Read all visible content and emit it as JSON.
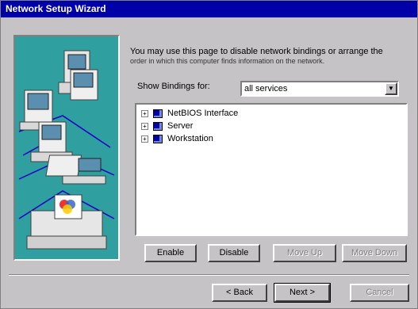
{
  "window": {
    "title": "Network Setup Wizard"
  },
  "description": {
    "line1": "You may use this page to disable network bindings or arrange the",
    "line2": "order in which this computer finds information on the network."
  },
  "bindings": {
    "show_label": "Show Bindings for:",
    "selected": "all services"
  },
  "tree": {
    "items": [
      {
        "expander": "+",
        "label": "NetBIOS Interface"
      },
      {
        "expander": "+",
        "label": "Server"
      },
      {
        "expander": "+",
        "label": "Workstation"
      }
    ]
  },
  "actions": {
    "enable": "Enable",
    "disable": "Disable",
    "move_up": "Move Up",
    "move_down": "Move Down"
  },
  "nav": {
    "back": "< Back",
    "next": "Next >",
    "cancel": "Cancel"
  },
  "colors": {
    "title_bar": "#0000a8",
    "illustration_bg": "#2f9f9f",
    "face": "#c6c3c6"
  },
  "icons": {
    "illustration": "network-computers-illustration",
    "binding_item": "network-component-icon",
    "dropdown": "chevron-down-icon"
  }
}
